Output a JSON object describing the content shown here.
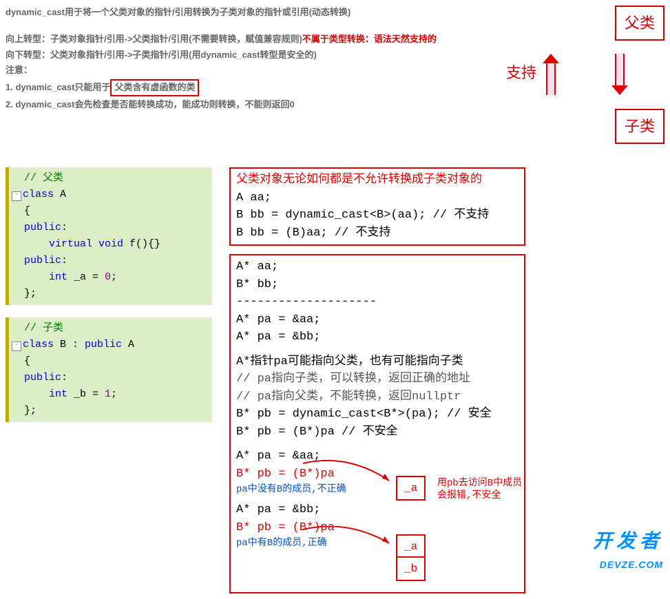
{
  "top": {
    "title": "dynamic_cast用于将一个父类对象的指针/引用转换为子类对象的指针或引用(动态转换)",
    "l1a": "向上转型：子类对象指针/引用->父类指针/引用(不需要转换，赋值兼容规则)",
    "l1_red": "不属于类型转换：语法天然支持的",
    "l2": "向下转型：父类对象指针/引用->子类指针/引用(用dynamic_cast转型是安全的)",
    "l3": "注意：",
    "l4a": "1. dynamic_cast只能用于",
    "l4_box": "父类含有虚函数的类",
    "l5": "2. dynamic_cast会先检查是否能转换成功，能成功则转换，不能则返回0"
  },
  "diagram": {
    "parent": "父类",
    "child": "子类",
    "support": "支持"
  },
  "code": {
    "a_comment": "// 父类",
    "a_class": "class",
    "a_name": " A",
    "a_pub": "public",
    "a_virtual": "    virtual void",
    "a_fn": " f(){}",
    "a_int": "    int",
    "a_var": " _a = ",
    "a_zero": "0",
    "b_comment": "// 子类",
    "b_class": "class",
    "b_name": " B : ",
    "b_pub_kw": "public",
    "b_parent": " A",
    "b_pub": "public",
    "b_int": "    int",
    "b_var": " _b = ",
    "b_one": "1",
    "semi": ";",
    "brace_o": "{",
    "brace_c": "};",
    "colon": ":"
  },
  "rbox1": {
    "title": "父类对象无论如何都是不允许转换成子类对象的",
    "l1": "A aa;",
    "l2": "B bb = dynamic_cast<B>(aa); // 不支持",
    "l3": "B bb = (B)aa; // 不支持"
  },
  "big": {
    "aa": "A* aa;",
    "bb": "B* bb;",
    "sep": "--------------------",
    "pa1": "A* pa = &aa;",
    "pa2": "A* pa = &bb;",
    "note1": "A*指针pa可能指向父类，也有可能指向子类",
    "note2": "// pa指向子类，可以转换，返回正确的地址",
    "note3": "// pa指向父类，不能转换，返回nullptr",
    "safe": "B* pb = dynamic_cast<B*>(pa); // 安全",
    "unsafe": "B* pb = (B*)pa              // 不安全",
    "ex1_l1": "A* pa = &aa;",
    "ex1_l2": "B* pb = (B*)pa",
    "ex1_note": "pa中没有B的成员,不正确",
    "ex2_l1": "A* pa = &bb;",
    "ex2_l2": "B* pb = (B*)pa",
    "ex2_note": "pa中有B的成员,正确",
    "sm_a": "_a",
    "sm_b": "_b",
    "anno1": "用pb去访问B中成员",
    "anno2": "会报错,不安全"
  },
  "watermark": {
    "big": "开发者",
    "small": "DEVZE.COM"
  }
}
